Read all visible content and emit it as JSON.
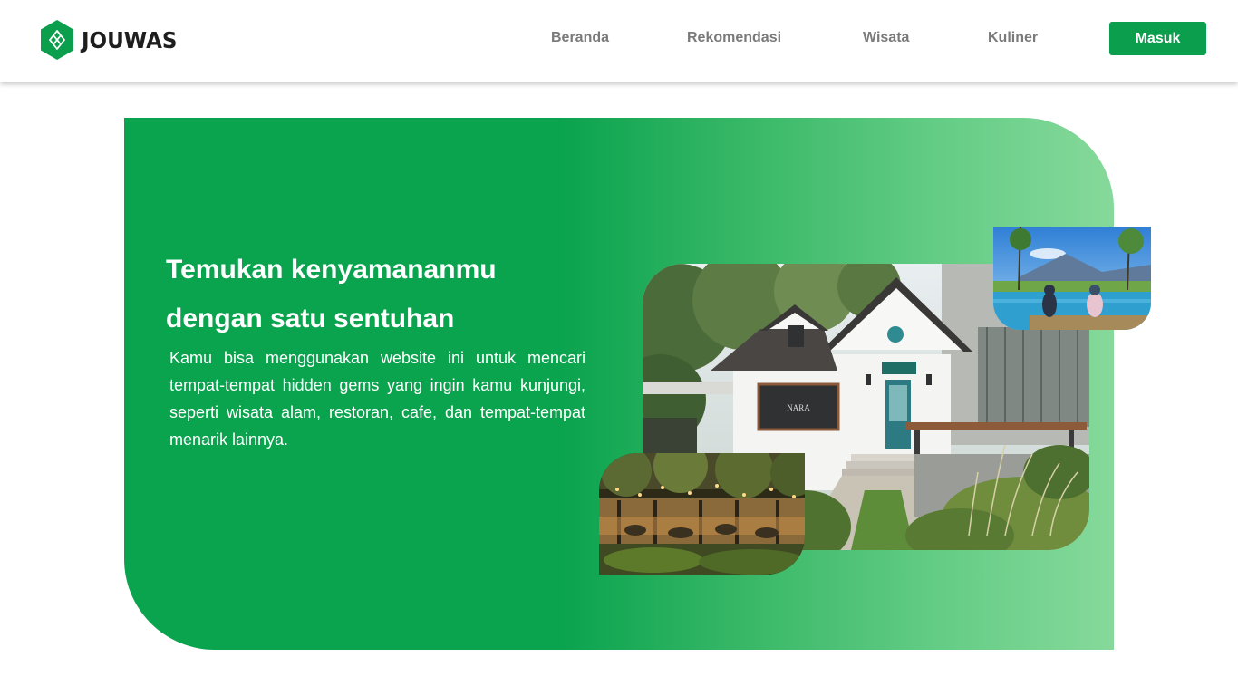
{
  "brand": {
    "name": "JOUWAS"
  },
  "nav": {
    "items": [
      "Beranda",
      "Rekomendasi",
      "Wisata",
      "Kuliner"
    ],
    "login_label": "Masuk"
  },
  "hero": {
    "title_line1": "Temukan kenyamananmu",
    "title_line2": "dengan satu sentuhan",
    "description": "Kamu bisa menggunakan website ini untuk mencari tempat-tempat hidden gems yang ingin kamu kunjungi, seperti wisata alam, restoran, cafe, dan tempat-tempat menarik lainnya.",
    "cafe_sign": "NARA"
  },
  "colors": {
    "brand_green": "#0b9e4c",
    "nav_text": "#7a7a7a",
    "logo_text": "#1e1e1e"
  },
  "icons": {
    "logo": "hexagon-leaf-logo-icon"
  }
}
